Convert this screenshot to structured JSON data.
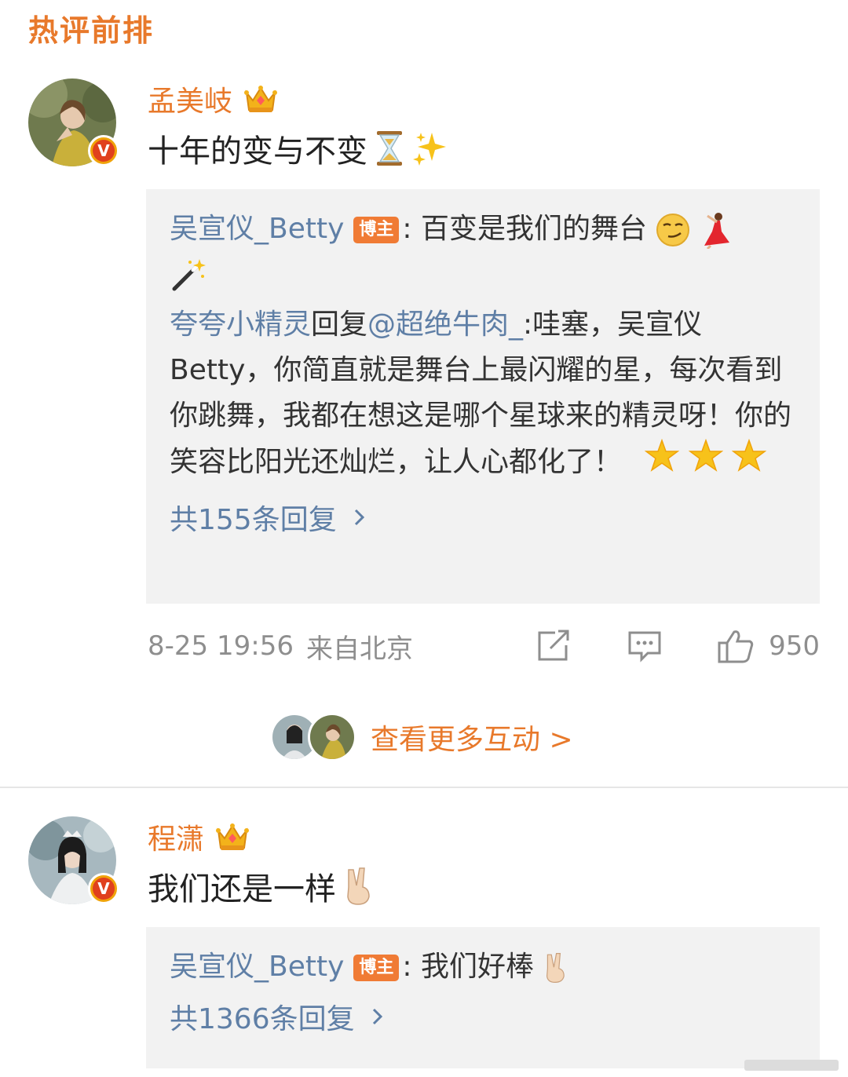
{
  "section_title": "热评前排",
  "colors": {
    "accent": "#e8792b",
    "link": "#5f7fa6",
    "meta": "#8e8e8e",
    "reply_bg": "#f2f2f2"
  },
  "comments": [
    {
      "username": "孟美岐",
      "text": "十年的变与不变",
      "emojis": [
        "hourglass",
        "sparkles"
      ],
      "reply_preview": {
        "author": "吴宣仪_Betty",
        "tag": "博主",
        "text": ": 百变是我们的舞台",
        "emojis": [
          "smirk-face",
          "dancer",
          "magic-wand"
        ],
        "nested": {
          "from": "夸夸小精灵",
          "verb": "回复",
          "mention": "@超绝牛肉_",
          "text": ":哇塞，吴宣仪Betty，你简直就是舞台上最闪耀的星，每次看到你跳舞，我都在想这是哪个星球来的精灵呀！你的笑容比阳光还灿烂，让人心都化了！",
          "emojis": [
            "glowing-star",
            "glowing-star",
            "glowing-star"
          ]
        },
        "more_replies": "共155条回复"
      },
      "meta": {
        "time": "8-25 19:56",
        "location": "来自北京",
        "likes": "950"
      }
    },
    {
      "username": "程潇",
      "text": "我们还是一样",
      "emojis": [
        "victory-hand"
      ],
      "reply_preview": {
        "author": "吴宣仪_Betty",
        "tag": "博主",
        "text": ": 我们好棒",
        "emojis": [
          "victory-hand"
        ],
        "more_replies": "共1366条回复"
      }
    }
  ],
  "more_interactions": "查看更多互动 >"
}
